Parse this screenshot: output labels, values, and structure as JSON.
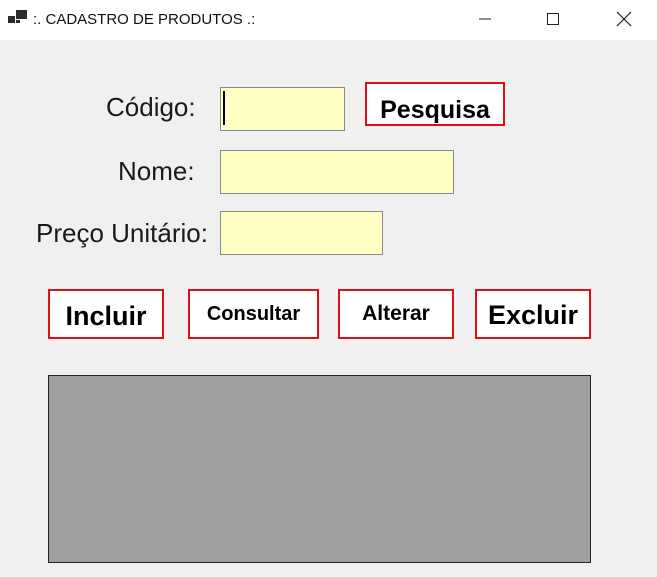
{
  "window": {
    "title": ":. CADASTRO DE PRODUTOS .:",
    "icon": "app-form-icon",
    "controls": [
      "minimize-icon",
      "maximize-icon",
      "close-icon"
    ]
  },
  "form": {
    "codigo_label": "Código:",
    "codigo_value": "",
    "nome_label": "Nome:",
    "nome_value": "",
    "preco_label": "Preço Unitário:",
    "preco_value": ""
  },
  "buttons": {
    "pesquisa": "Pesquisa",
    "incluir": "Incluir",
    "consultar": "Consultar",
    "alterar": "Alterar",
    "excluir": "Excluir"
  },
  "colors": {
    "field_background": "#ffffc4",
    "button_border": "#e01010",
    "grid_background": "#a0a0a0",
    "form_background": "#f0f0f0"
  }
}
